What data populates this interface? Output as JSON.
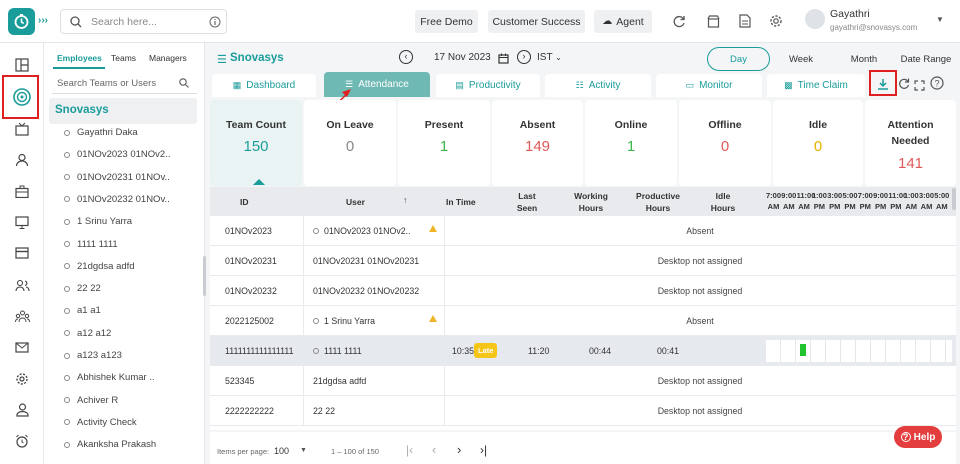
{
  "topbar": {
    "search_placeholder": "Search here...",
    "free_demo": "Free Demo",
    "customer_success": "Customer Success",
    "agent": "Agent",
    "user_name": "Gayathri",
    "user_email": "gayathri@snovasys.com"
  },
  "team_panel": {
    "tabs": [
      "Employees",
      "Teams",
      "Managers"
    ],
    "search_placeholder": "Search Teams or Users",
    "group_name": "Snovasys",
    "members": [
      "Gayathri Daka",
      "01NOv2023 01NOv2..",
      "01NOv20231 01NOv..",
      "01NOv20232 01NOv..",
      "1 Srinu Yarra",
      "1111 1111",
      "21dgdsa adfd",
      "22 22",
      "a1 a1",
      "a12 a12",
      "a123 a123",
      "Abhishek Kumar ..",
      "Achiver R",
      "Activity Check",
      "Akanksha Prakash"
    ]
  },
  "main": {
    "org_name": "Snovasys",
    "date": "17 Nov 2023",
    "timezone": "IST",
    "view_tabs": [
      "Day",
      "Week",
      "Month",
      "Date Range"
    ],
    "nav_tabs": [
      "Dashboard",
      "Attendance",
      "Productivity",
      "Activity",
      "Monitor",
      "Time Claim"
    ],
    "cards": [
      {
        "label": "Team Count",
        "value": "150",
        "color": "#1a9c9a"
      },
      {
        "label": "On Leave",
        "value": "0",
        "color": "#888888"
      },
      {
        "label": "Present",
        "value": "1",
        "color": "#3bb54a"
      },
      {
        "label": "Absent",
        "value": "149",
        "color": "#e05a5a"
      },
      {
        "label": "Online",
        "value": "1",
        "color": "#3bb54a"
      },
      {
        "label": "Offline",
        "value": "0",
        "color": "#e05a5a"
      },
      {
        "label": "Idle",
        "value": "0",
        "color": "#e8b100"
      },
      {
        "label": "Attention Needed",
        "value": "141",
        "color": "#e05a5a"
      }
    ]
  },
  "table": {
    "headers": {
      "id": "ID",
      "user": "User",
      "in_time": "In Time",
      "last_seen": "Last Seen",
      "working": "Working Hours",
      "productive": "Productive Hours",
      "idle": "Idle Hours"
    },
    "timeline_hours": [
      "7:00 AM",
      "9:00 AM",
      "11:00 AM",
      "1:00 PM",
      "3:00 PM",
      "5:00 PM",
      "7:00 PM",
      "9:00 PM",
      "11:00 PM",
      "1:00 AM",
      "3:00 AM",
      "5:00 AM"
    ],
    "rows": [
      {
        "id": "01NOv2023",
        "user": "01NOv2023 01NOv2..",
        "warn": true,
        "status": "Absent"
      },
      {
        "id": "01NOv20231",
        "user": "01NOv20231 01NOv20231",
        "warn": false,
        "status": "Desktop not assigned"
      },
      {
        "id": "01NOv20232",
        "user": "01NOv20232 01NOv20232",
        "warn": false,
        "status": "Desktop not assigned"
      },
      {
        "id": "2022125002",
        "user": "1 Srinu Yarra",
        "warn": true,
        "status": "Absent"
      },
      {
        "id": "1111111111111111",
        "user": "1111 1111",
        "warn": false,
        "status": "",
        "in_time": "10:35",
        "late": "Late",
        "last_seen": "11:20",
        "working": "00:44",
        "productive": "00:41"
      },
      {
        "id": "523345",
        "user": "21dgdsa adfd",
        "warn": false,
        "status": "Desktop not assigned"
      },
      {
        "id": "2222222222",
        "user": "22 22",
        "warn": false,
        "status": "Desktop not assigned"
      }
    ]
  },
  "footer": {
    "items_per_page_label": "Items per page:",
    "items_per_page": "100",
    "range": "1 – 100 of 150"
  },
  "help": "Help"
}
